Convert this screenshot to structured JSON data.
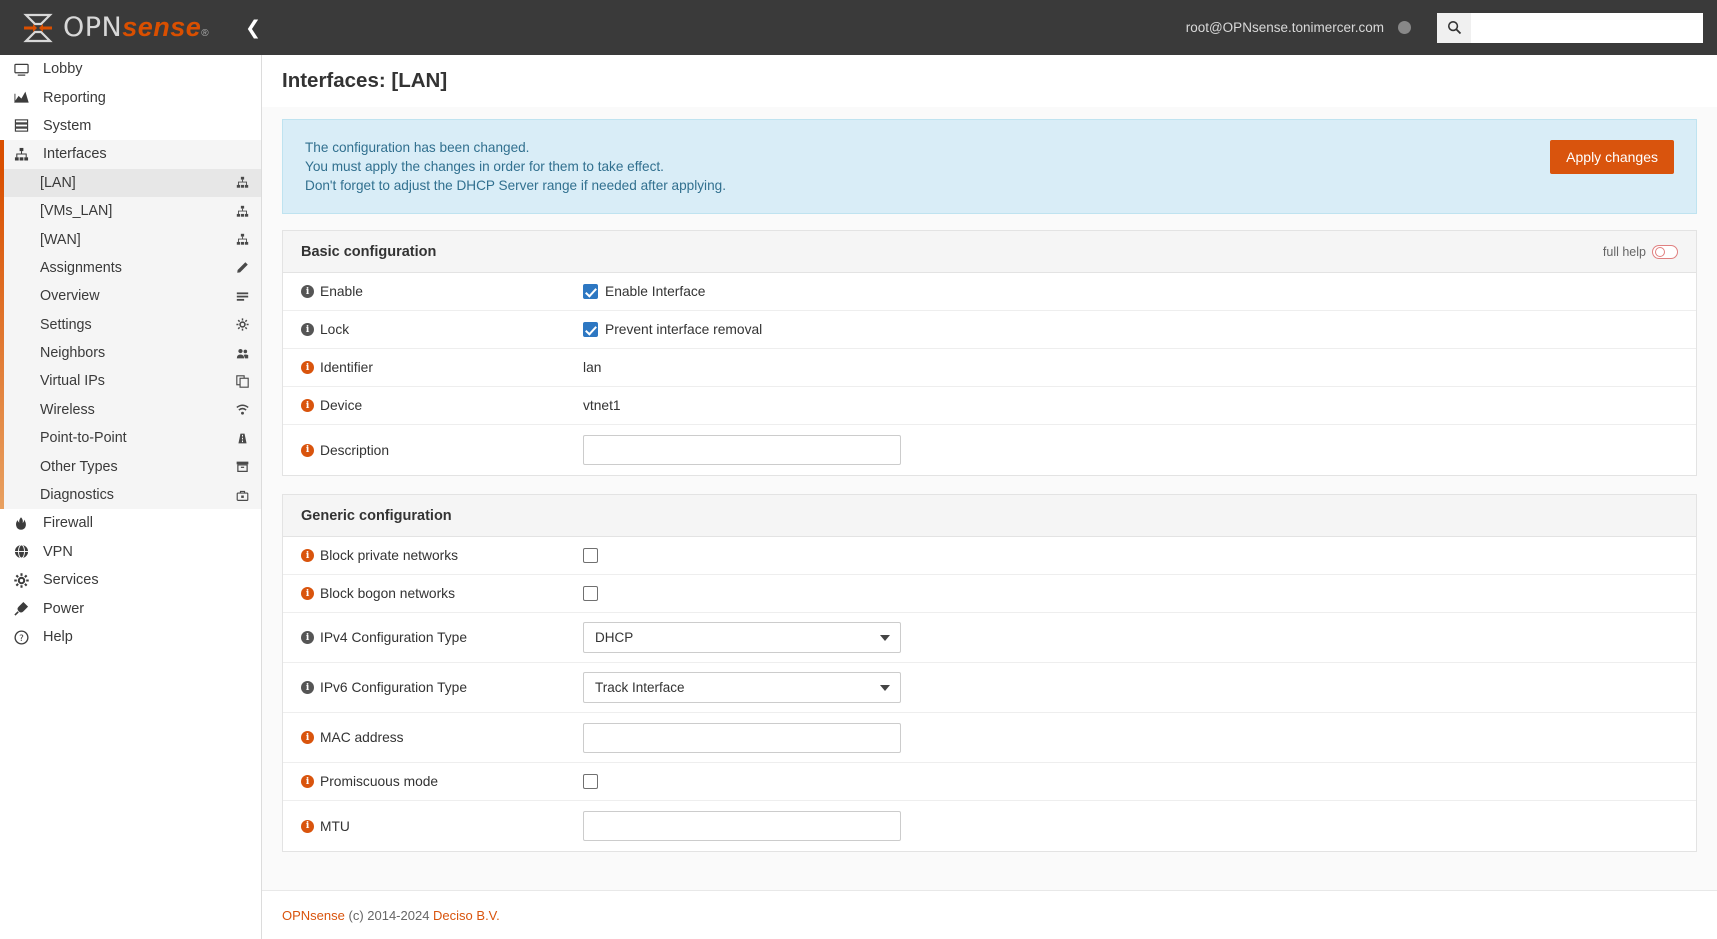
{
  "topbar": {
    "logo_opn": "OPN",
    "logo_sense": "sense",
    "logo_reg": "®",
    "collapse_icon": "chevron-left-icon",
    "user": "root@OPNsense.tonimercer.com",
    "search_icon": "search-icon",
    "search_value": "",
    "search_placeholder": ""
  },
  "sidebar": {
    "top_items": [
      {
        "label": "Lobby",
        "icon": "monitor-icon"
      },
      {
        "label": "Reporting",
        "icon": "chart-area-icon"
      },
      {
        "label": "System",
        "icon": "server-icon"
      },
      {
        "label": "Interfaces",
        "icon": "sitemap-icon"
      }
    ],
    "sub_items": [
      {
        "label": "[LAN]",
        "icon": "sitemap-icon",
        "selected": true
      },
      {
        "label": "[VMs_LAN]",
        "icon": "sitemap-icon",
        "selected": false
      },
      {
        "label": "[WAN]",
        "icon": "sitemap-icon",
        "selected": false
      },
      {
        "label": "Assignments",
        "icon": "pencil-icon",
        "selected": false
      },
      {
        "label": "Overview",
        "icon": "list-icon",
        "selected": false
      },
      {
        "label": "Settings",
        "icon": "gear-icon",
        "selected": false
      },
      {
        "label": "Neighbors",
        "icon": "users-icon",
        "selected": false
      },
      {
        "label": "Virtual IPs",
        "icon": "copy-icon",
        "selected": false
      },
      {
        "label": "Wireless",
        "icon": "wifi-icon",
        "selected": false
      },
      {
        "label": "Point-to-Point",
        "icon": "road-icon",
        "selected": false
      },
      {
        "label": "Other Types",
        "icon": "archive-icon",
        "selected": false
      },
      {
        "label": "Diagnostics",
        "icon": "toolbox-icon",
        "selected": false
      }
    ],
    "bottom_items": [
      {
        "label": "Firewall",
        "icon": "fire-icon"
      },
      {
        "label": "VPN",
        "icon": "globe-icon"
      },
      {
        "label": "Services",
        "icon": "gear-icon"
      },
      {
        "label": "Power",
        "icon": "plug-icon"
      },
      {
        "label": "Help",
        "icon": "help-circle-icon"
      }
    ]
  },
  "page": {
    "title": "Interfaces: [LAN]"
  },
  "alert": {
    "line1": "The configuration has been changed.",
    "line2": "You must apply the changes in order for them to take effect.",
    "line3": "Don't forget to adjust the DHCP Server range if needed after applying.",
    "apply_label": "Apply changes",
    "apply_color": "#d9540d",
    "bg_color": "#d9edf7",
    "text_color": "#31708f"
  },
  "basic_config": {
    "title": "Basic configuration",
    "full_help_label": "full help",
    "full_help_on": false,
    "rows": [
      {
        "label": "Enable",
        "info_color": "gray",
        "type": "checkbox",
        "checked": true,
        "checkbox_label": "Enable Interface"
      },
      {
        "label": "Lock",
        "info_color": "gray",
        "type": "checkbox",
        "checked": true,
        "checkbox_label": "Prevent interface removal"
      },
      {
        "label": "Identifier",
        "info_color": "orange",
        "type": "static",
        "value": "lan"
      },
      {
        "label": "Device",
        "info_color": "orange",
        "type": "static",
        "value": "vtnet1"
      },
      {
        "label": "Description",
        "info_color": "orange",
        "type": "text",
        "value": ""
      }
    ]
  },
  "generic_config": {
    "title": "Generic configuration",
    "rows": [
      {
        "label": "Block private networks",
        "info_color": "orange",
        "type": "checkbox",
        "checked": false,
        "checkbox_label": ""
      },
      {
        "label": "Block bogon networks",
        "info_color": "orange",
        "type": "checkbox",
        "checked": false,
        "checkbox_label": ""
      },
      {
        "label": "IPv4 Configuration Type",
        "info_color": "gray",
        "type": "select",
        "value": "DHCP"
      },
      {
        "label": "IPv6 Configuration Type",
        "info_color": "gray",
        "type": "select",
        "value": "Track Interface"
      },
      {
        "label": "MAC address",
        "info_color": "orange",
        "type": "text",
        "value": ""
      },
      {
        "label": "Promiscuous mode",
        "info_color": "orange",
        "type": "checkbox",
        "checked": false,
        "checkbox_label": ""
      },
      {
        "label": "MTU",
        "info_color": "orange",
        "type": "text",
        "value": ""
      }
    ]
  },
  "footer": {
    "link1": "OPNsense",
    "middle": " (c) 2014-2024 ",
    "link2": "Deciso B.V.",
    "link_color": "#d9540d"
  }
}
